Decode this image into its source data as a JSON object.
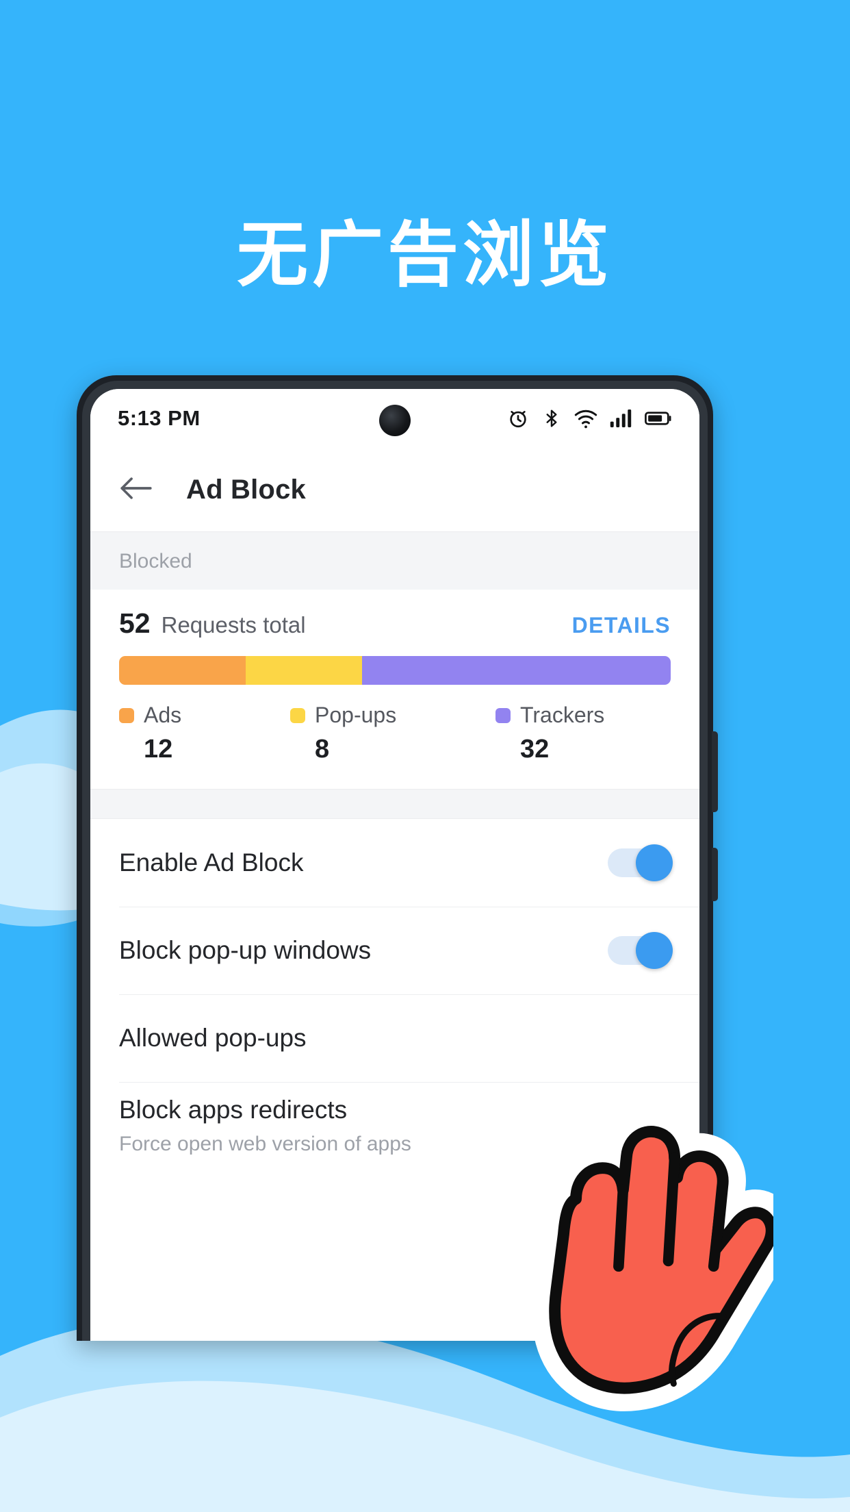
{
  "promo": {
    "headline": "无广告浏览",
    "background_color": "#35b4fb",
    "wave_color": "#b5e4fd"
  },
  "phone": {
    "status_bar": {
      "time": "5:13 PM",
      "icons": [
        "alarm-icon",
        "bluetooth-icon",
        "wifi-icon",
        "cellular-signal-icon",
        "battery-icon"
      ]
    },
    "app_bar": {
      "back_icon": "back-arrow-icon",
      "title": "Ad Block"
    },
    "section_header": "Blocked",
    "stats": {
      "total_value": "52",
      "total_label": "Requests total",
      "details_label": "DETAILS",
      "details_color": "#4a9cf0",
      "bar": [
        {
          "name": "Ads",
          "color": "#f9a44a",
          "percent": 23
        },
        {
          "name": "Pop-ups",
          "color": "#fcd645",
          "percent": 21
        },
        {
          "name": "Trackers",
          "color": "#9283f0",
          "percent": 56
        }
      ],
      "legend": [
        {
          "label": "Ads",
          "value": "12",
          "color": "#f9a44a"
        },
        {
          "label": "Pop-ups",
          "value": "8",
          "color": "#fcd645"
        },
        {
          "label": "Trackers",
          "value": "32",
          "color": "#9283f0"
        }
      ]
    },
    "settings": [
      {
        "title": "Enable Ad Block",
        "subtitle": "",
        "toggle": "on"
      },
      {
        "title": "Block pop-up windows",
        "subtitle": "",
        "toggle": "on"
      },
      {
        "title": "Allowed pop-ups",
        "subtitle": "",
        "toggle": "none"
      },
      {
        "title": "Block apps redirects",
        "subtitle": "Force open web version of apps",
        "toggle": "none"
      }
    ]
  },
  "sticker": {
    "name": "raised-hand-sticker",
    "fill_color": "#f8604e",
    "outline_color": "#0d0d0d",
    "border_color": "#ffffff"
  }
}
